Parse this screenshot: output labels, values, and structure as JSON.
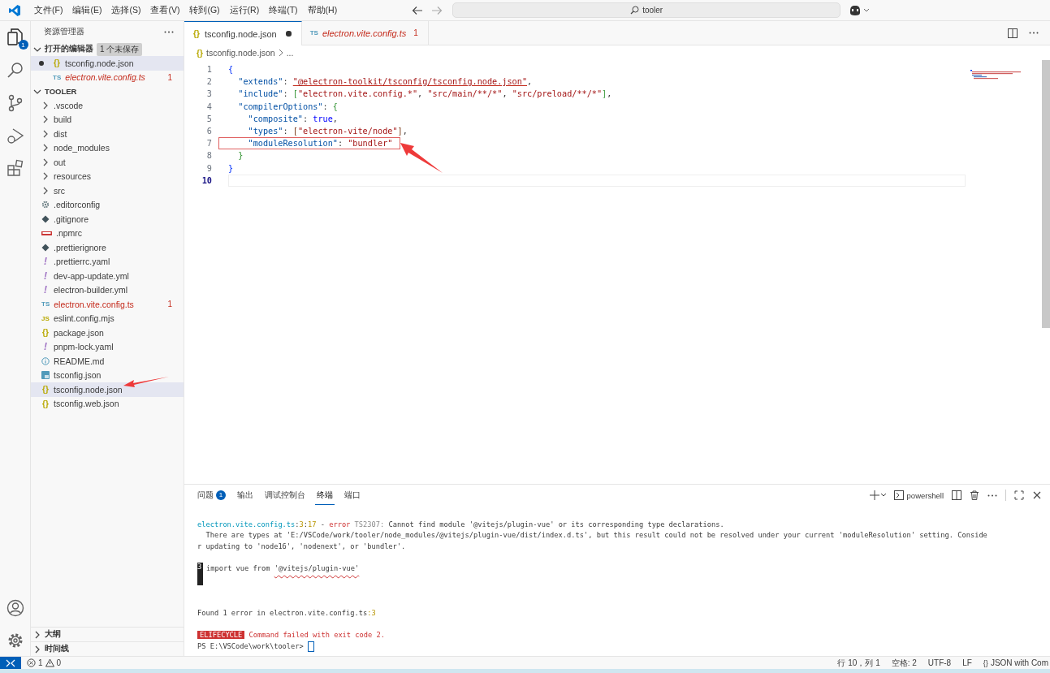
{
  "menu": [
    "文件(F)",
    "编辑(E)",
    "选择(S)",
    "查看(V)",
    "转到(G)",
    "运行(R)",
    "终端(T)",
    "帮助(H)"
  ],
  "search": {
    "value": "tooler"
  },
  "activity_bar": {
    "explorer_badge": "1"
  },
  "sidebar": {
    "title": "资源管理器",
    "open_editors": {
      "title": "打开的编辑器",
      "badge": "1 个未保存",
      "expanded": true,
      "items": [
        {
          "kind": "json",
          "icon": "{}",
          "name": "tsconfig.node.json",
          "dirty": true,
          "error": false,
          "selected": true
        },
        {
          "kind": "ts",
          "icon": "TS",
          "name": "electron.vite.config.ts",
          "error": true,
          "selected": false,
          "problems": "1"
        }
      ]
    },
    "folder": {
      "title": "TOOLER",
      "expanded": true,
      "items": [
        {
          "kind": "folder",
          "name": ".vscode",
          "selected": false,
          "error": false
        },
        {
          "kind": "folder",
          "name": "build",
          "selected": false,
          "error": false
        },
        {
          "kind": "folder",
          "name": "dist",
          "selected": false,
          "error": false
        },
        {
          "kind": "folder",
          "name": "node_modules",
          "selected": false,
          "error": false
        },
        {
          "kind": "folder",
          "name": "out",
          "selected": false,
          "error": false
        },
        {
          "kind": "folder",
          "name": "resources",
          "selected": false,
          "error": false
        },
        {
          "kind": "folder",
          "name": "src",
          "selected": false,
          "error": false
        },
        {
          "kind": "settings",
          "name": ".editorconfig",
          "selected": false,
          "error": false
        },
        {
          "kind": "git",
          "name": ".gitignore",
          "selected": false,
          "error": false
        },
        {
          "kind": "npm",
          "name": ".npmrc",
          "selected": false,
          "error": false
        },
        {
          "kind": "git",
          "name": ".prettierignore",
          "selected": false,
          "error": false
        },
        {
          "kind": "yaml",
          "icon": "!",
          "name": ".prettierrc.yaml",
          "selected": false,
          "error": false
        },
        {
          "kind": "yaml",
          "icon": "!",
          "name": "dev-app-update.yml",
          "selected": false,
          "error": false
        },
        {
          "kind": "yaml",
          "icon": "!",
          "name": "electron-builder.yml",
          "selected": false,
          "error": false
        },
        {
          "kind": "ts",
          "icon": "TS",
          "name": "electron.vite.config.ts",
          "selected": false,
          "error": true,
          "problems": "1"
        },
        {
          "kind": "js",
          "icon": "JS",
          "name": "eslint.config.mjs",
          "selected": false,
          "error": false
        },
        {
          "kind": "json",
          "icon": "{}",
          "name": "package.json",
          "selected": false,
          "error": false
        },
        {
          "kind": "yaml",
          "icon": "!",
          "name": "pnpm-lock.yaml",
          "selected": false,
          "error": false
        },
        {
          "kind": "info",
          "name": "README.md",
          "selected": false,
          "error": false
        },
        {
          "kind": "tsconfig",
          "name": "tsconfig.json",
          "selected": false,
          "error": false
        },
        {
          "kind": "json",
          "icon": "{}",
          "name": "tsconfig.node.json",
          "selected": true,
          "error": false,
          "pointed": true
        },
        {
          "kind": "json",
          "icon": "{}",
          "name": "tsconfig.web.json",
          "selected": false,
          "error": false
        }
      ]
    },
    "bottom_sections": [
      {
        "title": "大纲",
        "expanded": false
      },
      {
        "title": "时间线",
        "expanded": false
      }
    ]
  },
  "tabs": [
    {
      "kind": "json",
      "icon": "{}",
      "label": "tsconfig.node.json",
      "selected": true,
      "dirty": true,
      "error": false
    },
    {
      "kind": "ts",
      "icon": "TS",
      "label": "electron.vite.config.ts",
      "selected": false,
      "error": true,
      "problems": "1"
    }
  ],
  "breadcrumb": {
    "icon": "{}",
    "file": "tsconfig.node.json",
    "rest": "..."
  },
  "code_lines": [
    {
      "number": "1",
      "tokens": [
        {
          "kind": "brace1",
          "text": "{"
        }
      ]
    },
    {
      "number": "2",
      "tokens": [
        {
          "kind": "key",
          "text": "  \"extends\""
        },
        {
          "kind": "plain",
          "text": ": "
        },
        {
          "kind": "string",
          "text": "\"@electron-toolkit/tsconfig/tsconfig.node.json\"",
          "underlined": true
        },
        {
          "kind": "plain",
          "text": ","
        }
      ]
    },
    {
      "number": "3",
      "tokens": [
        {
          "kind": "key",
          "text": "  \"include\""
        },
        {
          "kind": "plain",
          "text": ": "
        },
        {
          "kind": "brace2",
          "text": "["
        },
        {
          "kind": "string",
          "text": "\"electron.vite.config.*\""
        },
        {
          "kind": "plain",
          "text": ", "
        },
        {
          "kind": "string",
          "text": "\"src/main/**/*\""
        },
        {
          "kind": "plain",
          "text": ", "
        },
        {
          "kind": "string",
          "text": "\"src/preload/**/*\""
        },
        {
          "kind": "brace2",
          "text": "]"
        },
        {
          "kind": "plain",
          "text": ","
        }
      ]
    },
    {
      "number": "4",
      "tokens": [
        {
          "kind": "key",
          "text": "  \"compilerOptions\""
        },
        {
          "kind": "plain",
          "text": ": "
        },
        {
          "kind": "brace2",
          "text": "{"
        }
      ]
    },
    {
      "number": "5",
      "tokens": [
        {
          "kind": "key",
          "text": "    \"composite\""
        },
        {
          "kind": "plain",
          "text": ": "
        },
        {
          "kind": "bool",
          "text": "true"
        },
        {
          "kind": "plain",
          "text": ","
        }
      ]
    },
    {
      "number": "6",
      "tokens": [
        {
          "kind": "key",
          "text": "    \"types\""
        },
        {
          "kind": "plain",
          "text": ": "
        },
        {
          "kind": "brace3",
          "text": "["
        },
        {
          "kind": "string",
          "text": "\"electron-vite/node\""
        },
        {
          "kind": "brace3",
          "text": "]"
        },
        {
          "kind": "plain",
          "text": ","
        }
      ]
    },
    {
      "number": "7",
      "boxed": true,
      "tokens": [
        {
          "kind": "key",
          "text": "    \"moduleResolution\""
        },
        {
          "kind": "plain",
          "text": ": "
        },
        {
          "kind": "string",
          "text": "\"bundler\""
        }
      ]
    },
    {
      "number": "8",
      "tokens": [
        {
          "kind": "brace2",
          "text": "  }"
        }
      ]
    },
    {
      "number": "9",
      "tokens": [
        {
          "kind": "brace1",
          "text": "}"
        }
      ]
    },
    {
      "number": "10",
      "current": true
    }
  ],
  "panel": {
    "tabs": [
      {
        "label": "问题",
        "badge": "1",
        "selected": false
      },
      {
        "label": "输出",
        "selected": false
      },
      {
        "label": "调试控制台",
        "selected": false
      },
      {
        "label": "终端",
        "selected": true
      },
      {
        "label": "端口",
        "selected": false
      }
    ],
    "terminal_name": "powershell",
    "lines": [
      {
        "kind": "blank"
      },
      {
        "kind": "text",
        "tokens": [
          {
            "kind": "file",
            "text": "electron.vite.config.ts"
          },
          {
            "kind": "plain",
            "text": ":"
          },
          {
            "kind": "pos",
            "text": "3"
          },
          {
            "kind": "plain",
            "text": ":"
          },
          {
            "kind": "pos",
            "text": "17"
          },
          {
            "kind": "plain",
            "text": " - "
          },
          {
            "kind": "error",
            "text": "error"
          },
          {
            "kind": "muted",
            "text": " TS2307: "
          },
          {
            "kind": "plain",
            "text": "Cannot find module '@vitejs/plugin-vue' or its corresponding type declarations."
          }
        ]
      },
      {
        "kind": "text",
        "tokens": [
          {
            "kind": "plain",
            "text": "  There are types at 'E:/VSCode/work/tooler/node_modules/@vitejs/plugin-vue/dist/index.d.ts', but this result could not be resolved under your current 'moduleResolution' setting. Conside"
          }
        ]
      },
      {
        "kind": "text",
        "tokens": [
          {
            "kind": "plain",
            "text": "r updating to 'node16', 'nodenext', or 'bundler'."
          }
        ]
      },
      {
        "kind": "blank"
      },
      {
        "kind": "source",
        "gutter": "3",
        "tokens": [
          {
            "kind": "plain",
            "text": "import vue from "
          },
          {
            "kind": "plain",
            "text": "'@vitejs/plugin-vue'",
            "squiggle": true
          }
        ]
      },
      {
        "kind": "squiggle"
      },
      {
        "kind": "blank"
      },
      {
        "kind": "blank"
      },
      {
        "kind": "text",
        "tokens": [
          {
            "kind": "plain",
            "text": "Found 1 error in electron.vite.config.ts"
          },
          {
            "kind": "pos",
            "text": ":3"
          }
        ]
      },
      {
        "kind": "blank"
      },
      {
        "kind": "text",
        "tokens": [
          {
            "kind": "badge",
            "text": "ELIFECYCLE"
          },
          {
            "kind": "error",
            "text": " Command failed with exit code 2."
          }
        ]
      },
      {
        "kind": "prompt",
        "tokens": [
          {
            "kind": "plain",
            "text": "PS E:\\VSCode\\work\\tooler> "
          }
        ]
      }
    ]
  },
  "status_bar": {
    "errors": "1",
    "warnings": "0",
    "items": [
      "行 10，列 1",
      "空格: 2",
      "UTF-8",
      "LF"
    ],
    "language_icon": "{}",
    "language": "JSON with Com"
  }
}
